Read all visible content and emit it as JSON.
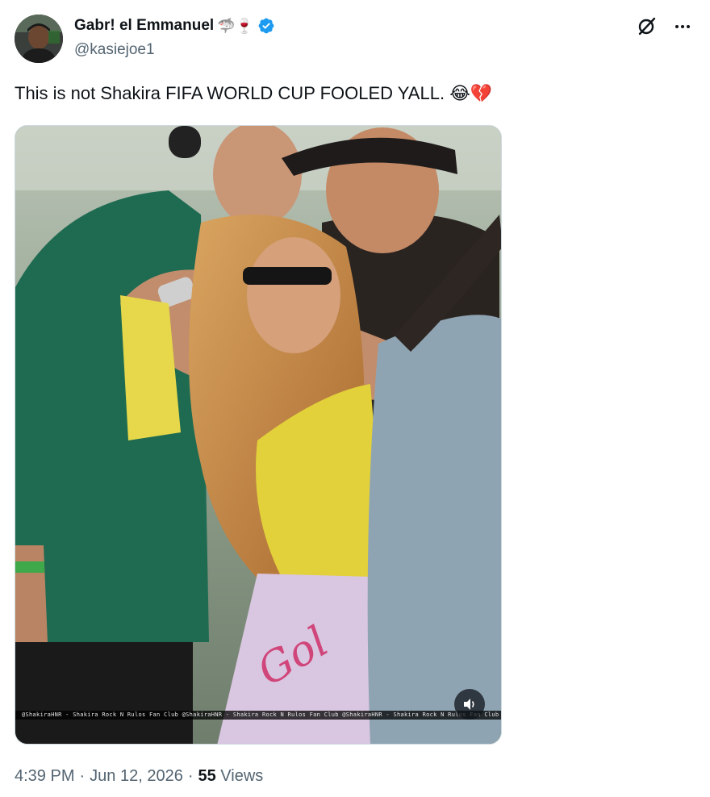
{
  "author": {
    "display_name": "Gabr! el Emmanuel",
    "name_emojis": "🦈🍷",
    "handle": "@kasiejoe1",
    "verified": true
  },
  "post": {
    "text": "This is not Shakira FIFA WORLD CUP FOOLED YALL.",
    "text_emojis": "😂💔"
  },
  "media": {
    "watermark": "@ShakiraHNR - Shakira Rock N Rulos Fan Club   @ShakiraHNR - Shakira Rock N Rulos Fan Club   @ShakiraHNR - Shakira Rock N Rulos Fan Club   @ShakiraHNR - Shakira Rock N Rulos Fan Club",
    "image_text": "Gol"
  },
  "meta": {
    "time": "4:39 PM",
    "date": "Jun 12, 2026",
    "views_count": "55",
    "views_label": "Views",
    "separator": "·"
  },
  "icons": {
    "verified": "verified-badge-icon",
    "grok": "grok-icon",
    "more": "more-icon",
    "sound": "speaker-icon"
  },
  "colors": {
    "verified_blue": "#1d9bf0",
    "text_primary": "#0f1419",
    "text_secondary": "#536471"
  }
}
